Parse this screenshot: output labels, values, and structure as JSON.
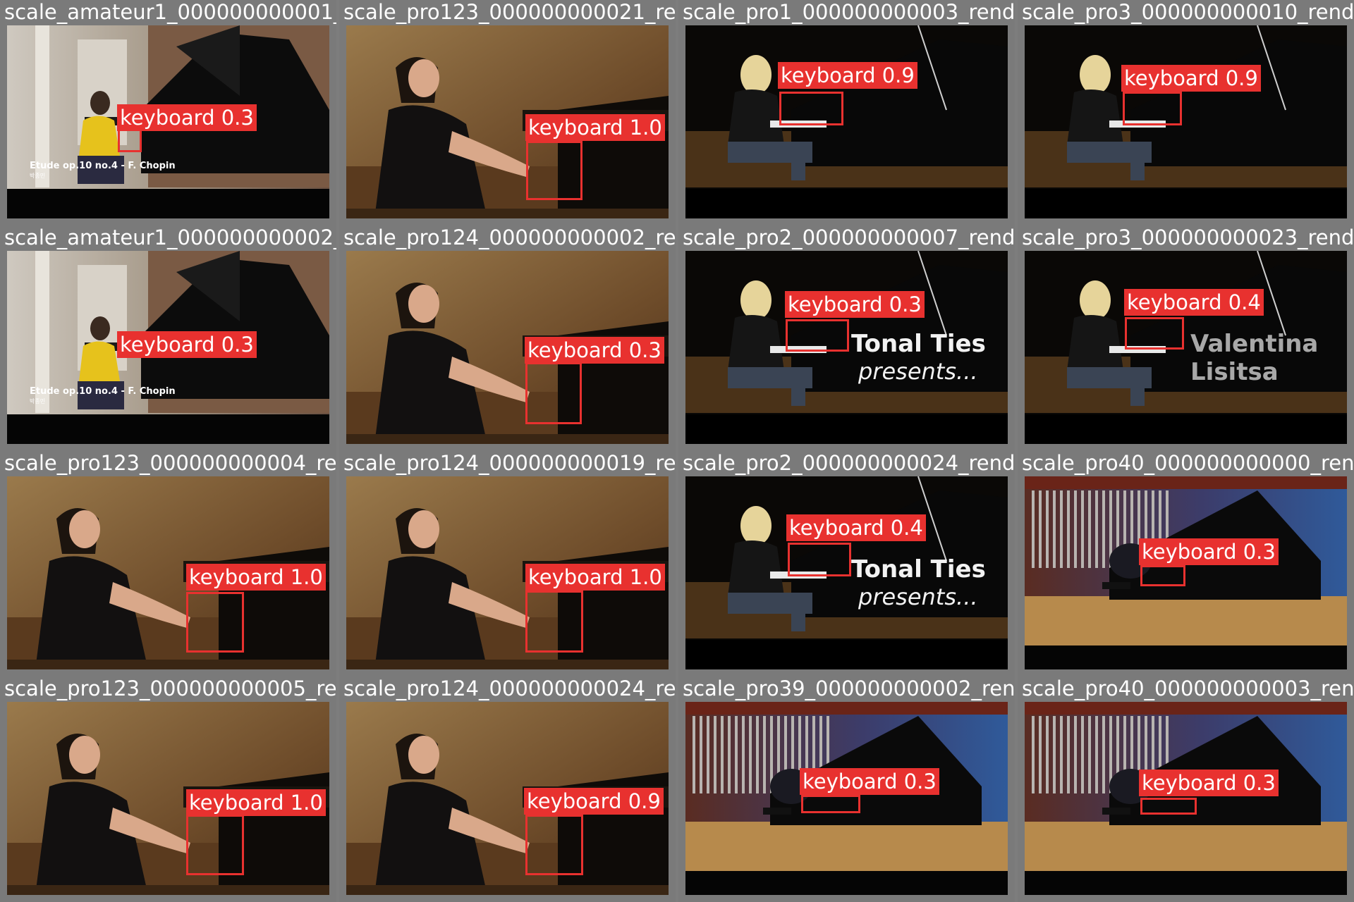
{
  "tiles": [
    {
      "id": "t1",
      "title": "scale_amateur1_000000000001_",
      "scene": "amateur",
      "label": "keyboard 0.3",
      "caption": {
        "line1": "Etude op.10 no.4 - F. Chopin",
        "line2": "박종민"
      }
    },
    {
      "id": "t2",
      "title": "scale_pro123_000000000021_re",
      "scene": "pro123",
      "label": "keyboard 1.0"
    },
    {
      "id": "t3",
      "title": "scale_pro1_000000000003_rend",
      "scene": "pro_blonde",
      "label": "keyboard 0.9"
    },
    {
      "id": "t4",
      "title": "scale_pro3_000000000010_rend",
      "scene": "pro_blonde",
      "label": "keyboard 0.9"
    },
    {
      "id": "t5",
      "title": "scale_amateur1_000000000002_",
      "scene": "amateur",
      "label": "keyboard 0.3",
      "caption": {
        "line1": "Etude op.10 no.4 - F. Chopin",
        "line2": "박종민"
      }
    },
    {
      "id": "t6",
      "title": "scale_pro124_000000000002_re",
      "scene": "pro123",
      "label": "keyboard 0.3"
    },
    {
      "id": "t7",
      "title": "scale_pro2_000000000007_rend",
      "scene": "pro_blonde",
      "label": "keyboard 0.3",
      "overlay": {
        "line1": "Tonal Ties",
        "line2": "presents..."
      }
    },
    {
      "id": "t8",
      "title": "scale_pro3_000000000023_rend",
      "scene": "pro_blonde",
      "label": "keyboard 0.4",
      "overlay_grey": {
        "line1": "Valentina",
        "line2": "Lisitsa"
      }
    },
    {
      "id": "t9",
      "title": "scale_pro123_000000000004_re",
      "scene": "pro123",
      "label": "keyboard 1.0"
    },
    {
      "id": "t10",
      "title": "scale_pro124_000000000019_re",
      "scene": "pro123",
      "label": "keyboard 1.0"
    },
    {
      "id": "t11",
      "title": "scale_pro2_000000000024_rend",
      "scene": "pro_blonde",
      "label": "keyboard 0.4",
      "overlay": {
        "line1": "Tonal Ties",
        "line2": "presents..."
      }
    },
    {
      "id": "t12",
      "title": "scale_pro40_000000000000_ren",
      "scene": "concert",
      "label": "keyboard 0.3"
    },
    {
      "id": "t13",
      "title": "scale_pro123_000000000005_re",
      "scene": "pro123",
      "label": "keyboard 1.0"
    },
    {
      "id": "t14",
      "title": "scale_pro124_000000000024_re",
      "scene": "pro123",
      "label": "keyboard 0.9"
    },
    {
      "id": "t15",
      "title": "scale_pro39_000000000002_ren",
      "scene": "concert",
      "label": "keyboard 0.3"
    },
    {
      "id": "t16",
      "title": "scale_pro40_000000000003_ren",
      "scene": "concert",
      "label": "keyboard 0.3"
    }
  ],
  "overlap_titles": [
    "scale_pro123_000000000021_re",
    "scale_pro124_000000000002_re",
    "scale_pro124_000000000019_re",
    "scale_pro124_000000000024_re"
  ]
}
